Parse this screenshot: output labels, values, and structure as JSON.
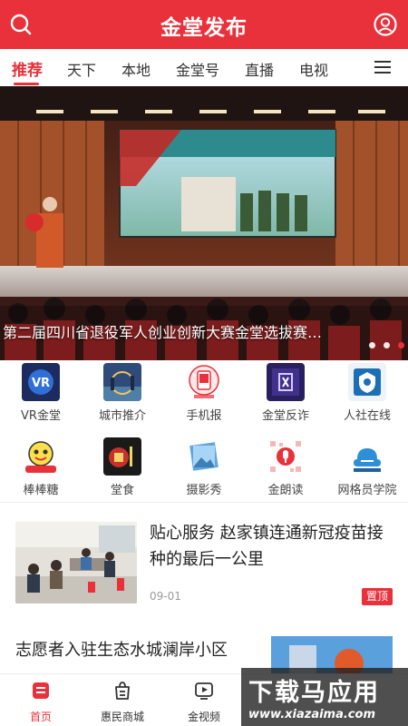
{
  "header": {
    "title": "金堂发布",
    "search_icon": "search-icon",
    "user_icon": "user-icon",
    "color": "#e8313a"
  },
  "tabs": [
    {
      "label": "推荐",
      "active": true
    },
    {
      "label": "天下"
    },
    {
      "label": "本地"
    },
    {
      "label": "金堂号"
    },
    {
      "label": "直播"
    },
    {
      "label": "电视"
    }
  ],
  "banner": {
    "caption": "第二届四川省退役军人创业创新大赛金堂选拔赛…",
    "dots": 3,
    "active_dot": 3
  },
  "apps": [
    {
      "label": "VR金堂",
      "icon": "vr-icon"
    },
    {
      "label": "城市推介",
      "icon": "city-icon"
    },
    {
      "label": "手机报",
      "icon": "mobile-paper-icon"
    },
    {
      "label": "金堂反诈",
      "icon": "anti-fraud-icon"
    },
    {
      "label": "人社在线",
      "icon": "social-security-icon"
    },
    {
      "label": "棒棒糖",
      "icon": "lollipop-icon"
    },
    {
      "label": "堂食",
      "icon": "dine-in-icon"
    },
    {
      "label": "摄影秀",
      "icon": "photo-show-icon"
    },
    {
      "label": "金朗读",
      "icon": "reading-icon"
    },
    {
      "label": "网格员学院",
      "icon": "grid-academy-icon"
    }
  ],
  "news": [
    {
      "title": "贴心服务 赵家镇连通新冠疫苗接种的最后一公里",
      "date": "09-01",
      "badge": "置顶"
    },
    {
      "title": "志愿者入驻生态水城澜岸小区"
    }
  ],
  "bottom_nav": [
    {
      "label": "首页",
      "active": true,
      "icon": "home-icon"
    },
    {
      "label": "惠民商城",
      "icon": "shop-icon"
    },
    {
      "label": "金视频",
      "icon": "video-icon"
    }
  ],
  "watermark": {
    "title": "下载马应用",
    "url": "www.xiazaima.com"
  }
}
